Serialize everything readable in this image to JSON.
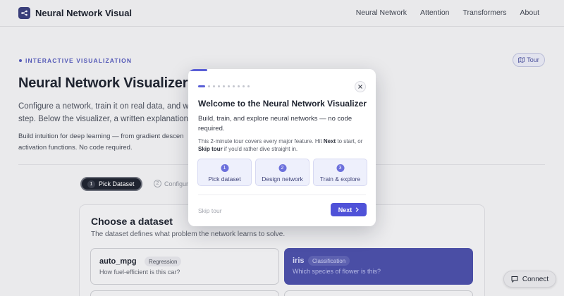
{
  "header": {
    "title": "Neural Network Visual",
    "nav": [
      "Neural Network",
      "Attention",
      "Transformers",
      "About"
    ]
  },
  "hero": {
    "eyebrow": "INTERACTIVE VISUALIZATION",
    "tour_label": "Tour",
    "title": "Neural Network Visualizer",
    "lead": "Configure a network, train it on real data, and watc",
    "lead_line2": "step. Below the visualizer, a written explanation wa",
    "sub": "Build intuition for deep learning — from gradient descen",
    "sub_line2": "activation functions. No code required."
  },
  "stepper": {
    "step1_num": "1",
    "step1_label": "Pick Dataset",
    "step2_num": "2",
    "step2_label": "Configur"
  },
  "dataset_panel": {
    "title": "Choose a dataset",
    "subtitle": "The dataset defines what problem the network learns to solve.",
    "cards": [
      {
        "name": "auto_mpg",
        "tag": "Regression",
        "desc": "How fuel-efficient is this car?"
      },
      {
        "name": "iris",
        "tag": "Classification",
        "desc": "Which species of flower is this?"
      }
    ]
  },
  "connect_label": "Connect",
  "modal": {
    "title": "Welcome to the Neural Network Visualizer",
    "lead": "Build, train, and explore neural networks — no code required.",
    "note_prefix": "This 2-minute tour covers every major feature. Hit ",
    "note_next": "Next",
    "note_mid": " to start, or ",
    "note_skip": "Skip tour",
    "note_suffix": " if you'd rather dive straight in.",
    "steps": [
      {
        "num": "1",
        "label": "Pick dataset"
      },
      {
        "num": "2",
        "label": "Design network"
      },
      {
        "num": "3",
        "label": "Train & explore"
      }
    ],
    "skip_label": "Skip tour",
    "next_label": "Next",
    "total_steps": 10,
    "current_step": 1
  },
  "colors": {
    "accent": "#5a5fd6",
    "selected_card": "#4a4ea5"
  }
}
